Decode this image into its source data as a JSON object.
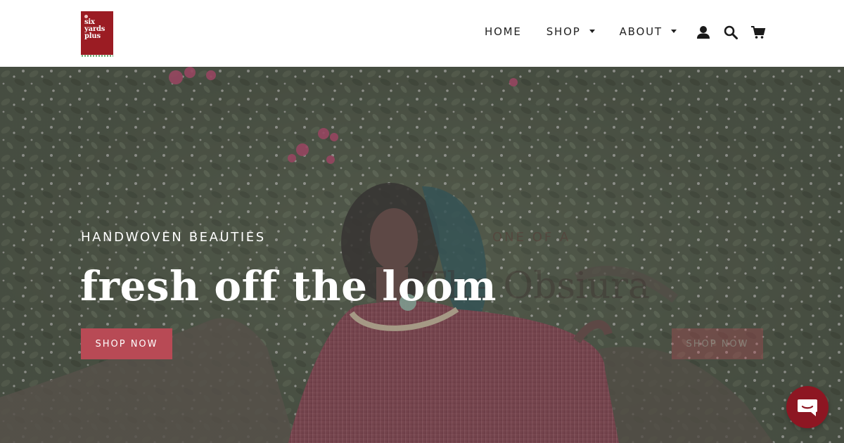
{
  "header": {
    "logo": {
      "lines": [
        "six",
        "yards",
        "plus"
      ],
      "colors": {
        "background": "#9b1c23",
        "accent_dots": "#2e8b3a"
      }
    },
    "nav": {
      "home": "HOME",
      "shop": "SHOP",
      "about": "ABOUT"
    },
    "icons": {
      "login": "user-icon",
      "search": "search-icon",
      "cart": "cart-icon"
    }
  },
  "hero": {
    "subtitle": "HANDWOVEN BEAUTIES",
    "title": "fresh off the loom",
    "button_label": "SHOP NOW",
    "button_color": "#b84a55",
    "transition_slide": {
      "subtitle": "ONE OF A",
      "title": "The Obsiura",
      "button_label": "SHOP NOW"
    }
  },
  "chat_widget": {
    "icon": "chat-bubble-icon",
    "color": "#8d1622"
  }
}
